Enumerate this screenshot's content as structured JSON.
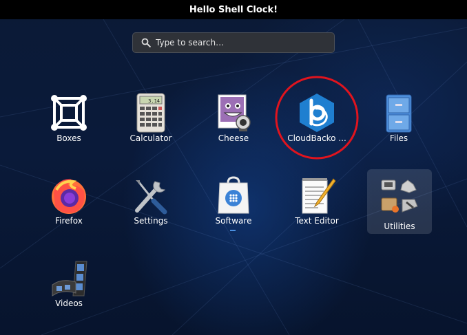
{
  "topbar": {
    "title": "Hello Shell Clock!"
  },
  "search": {
    "placeholder": "Type to search…",
    "icon": "search-icon"
  },
  "apps": [
    {
      "id": "boxes",
      "label": "Boxes",
      "icon": "boxes-icon"
    },
    {
      "id": "calculator",
      "label": "Calculator",
      "icon": "calculator-icon",
      "display": "3.14"
    },
    {
      "id": "cheese",
      "label": "Cheese",
      "icon": "cheese-icon"
    },
    {
      "id": "cloudbacko",
      "label": "CloudBacko ...",
      "icon": "cloudbacko-icon",
      "highlighted": true
    },
    {
      "id": "files",
      "label": "Files",
      "icon": "files-icon"
    },
    {
      "id": "firefox",
      "label": "Firefox",
      "icon": "firefox-icon"
    },
    {
      "id": "settings",
      "label": "Settings",
      "icon": "settings-icon"
    },
    {
      "id": "software",
      "label": "Software",
      "icon": "software-icon",
      "running": true
    },
    {
      "id": "texteditor",
      "label": "Text Editor",
      "icon": "text-editor-icon"
    },
    {
      "id": "utilities",
      "label": "Utilities",
      "icon": "folder-icon",
      "is_folder": true
    },
    {
      "id": "videos",
      "label": "Videos",
      "icon": "videos-icon"
    }
  ],
  "colors": {
    "highlight_circle": "#e0141e",
    "background": "#0a1a3a",
    "topbar": "#000000",
    "running_indicator": "#4a8fe0"
  }
}
